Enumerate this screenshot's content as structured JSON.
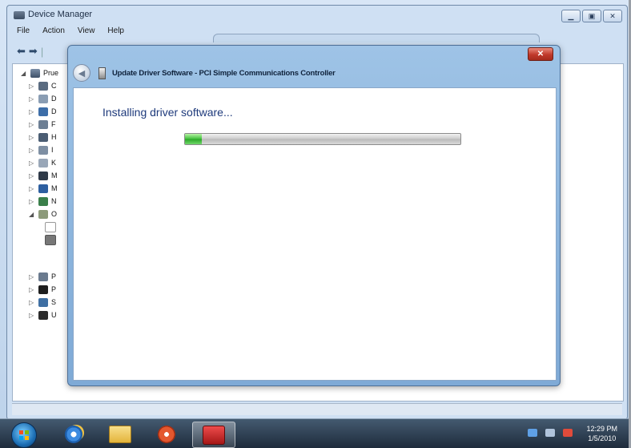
{
  "device_manager": {
    "title": "Device Manager",
    "menu": [
      "File",
      "Action",
      "View",
      "Help"
    ],
    "tree_root": "Prue",
    "tree_letters": [
      "C",
      "D",
      "D",
      "F",
      "H",
      "I",
      "K",
      "M",
      "M",
      "N",
      "O",
      "P",
      "P",
      "S",
      "U"
    ]
  },
  "dialog": {
    "title": "Update Driver Software - PCI Simple Communications Controller",
    "close_label": "✕",
    "status": "Installing driver software...",
    "progress": 0.06
  },
  "taskbar": {
    "clock_time": "12:29 PM",
    "clock_date": "1/5/2010"
  },
  "colors": {
    "dialog_frame": "#8fb6e0",
    "progress_green": "#3fbf3b",
    "close_red": "#c0392b"
  }
}
